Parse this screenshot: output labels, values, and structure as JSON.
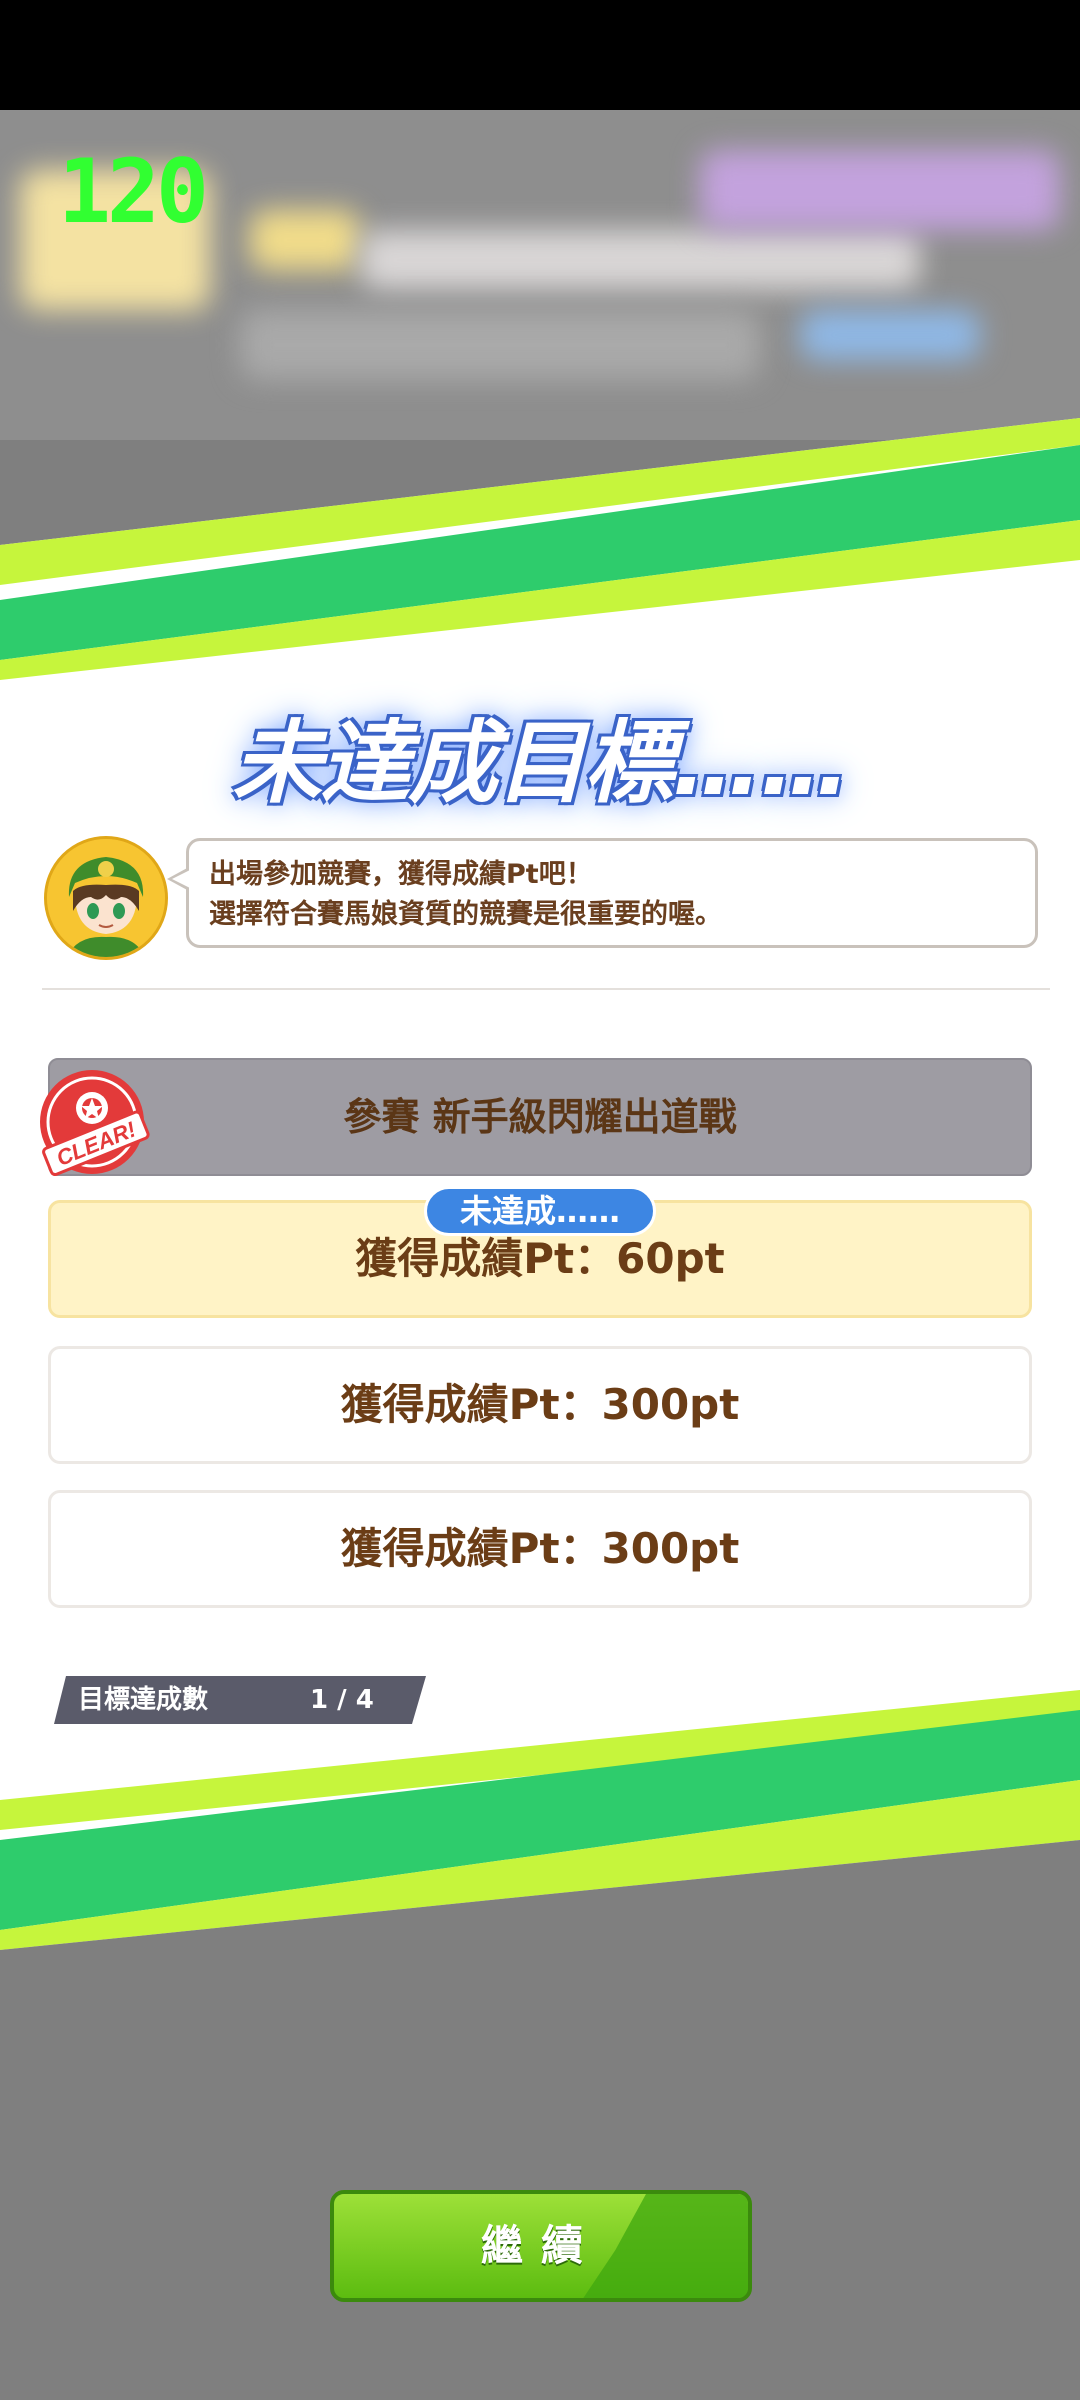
{
  "overlay": {
    "fps": "120"
  },
  "result": {
    "title": "未達成目標……",
    "message_lines": [
      "出場參加競賽，獲得成績Pt吧！",
      "選擇符合賽馬娘資質的競賽是很重要的喔。"
    ],
    "goal_header": "參賽 新手級閃耀出道戰",
    "clear_stamp_text": "CLEAR!",
    "status_pill": "未達成……",
    "targets": [
      {
        "label": "獲得成績Pt：60pt",
        "state": "current"
      },
      {
        "label": "獲得成績Pt：300pt",
        "state": "pending"
      },
      {
        "label": "獲得成績Pt：300pt",
        "state": "pending"
      }
    ],
    "counter": {
      "label": "目標達成數",
      "value": "1 / 4"
    }
  },
  "actions": {
    "continue_label": "繼續"
  },
  "colors": {
    "accent_green": "#2ecc6c",
    "accent_lime": "#c6f53c",
    "button_green": "#66c41a",
    "pill_blue": "#3d86e3",
    "text_brown": "#6b3d16"
  }
}
